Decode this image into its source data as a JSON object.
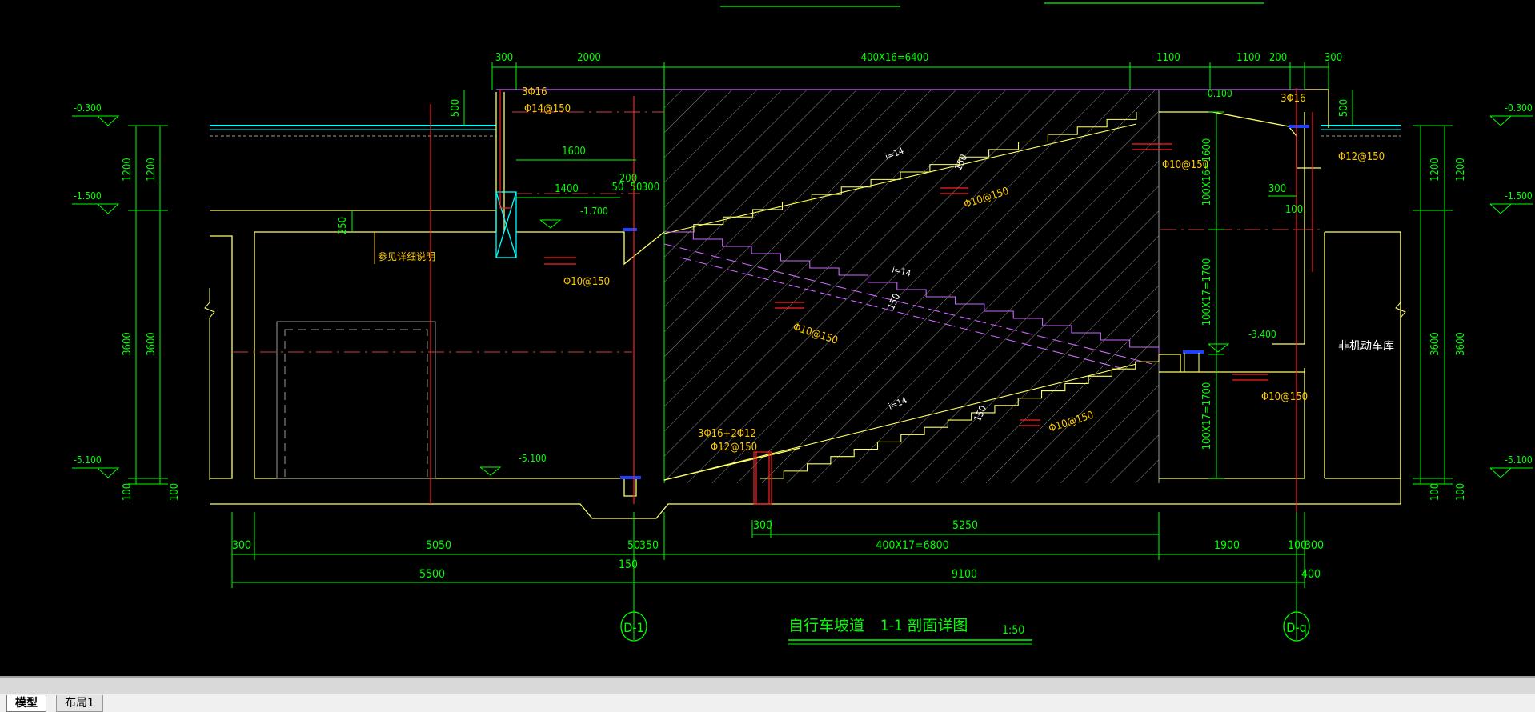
{
  "drawing": {
    "title": "自行车坡道",
    "section_label": "1-1  剖面详图",
    "scale": "1:50",
    "axis_left": "D-1",
    "axis_right": "D-q",
    "room_label": "非机动车库",
    "note_mid": "参见详细说明",
    "levels": {
      "top_left": "-0.300",
      "top_right": "-0.300",
      "mid_left": "-1.500",
      "mid_right": "-1.500",
      "bottom_left": "-5.100",
      "bottom_right": "-5.100",
      "landing_top": "-0.100",
      "landing_upper": "-1.700",
      "landing_mid": "-3.400",
      "floor": "-5.100"
    },
    "top_dims": [
      "300",
      "2000",
      "400X16=6400",
      "1100",
      "1100",
      "200",
      "300"
    ],
    "inner_dims": [
      "1600",
      "1400",
      "200",
      "50",
      "50",
      "300",
      "250",
      "500",
      "500",
      "300",
      "100"
    ],
    "bottom_dims_row1": [
      "300",
      "5050",
      "50",
      "350",
      "300",
      "5250",
      "400X17=6800",
      "1900",
      "100",
      "300"
    ],
    "bottom_dims_row2": [
      "5500",
      "150",
      "9100",
      "400"
    ],
    "left_vert_dims": [
      "1200",
      "1200",
      "3600",
      "3600",
      "100",
      "100"
    ],
    "right_vert_dims": [
      "1200",
      "1200",
      "3600",
      "3600",
      "100",
      "100"
    ],
    "stair_vert_dims": [
      "100X16=1600",
      "100X17=1700",
      "100X17=1700"
    ],
    "rebar_labels": [
      "3Φ16",
      "Φ14@150",
      "Φ10@150",
      "Φ10@150",
      "Φ10@150",
      "Φ10@150",
      "Φ10@150",
      "3Φ16",
      "Φ12@150",
      "3Φ16+2Φ12",
      "Φ12@150",
      "Φ10@150"
    ],
    "slope_labels": [
      "i=14",
      "i=14",
      "i=14"
    ],
    "slab_labels": [
      "150",
      "150",
      "150"
    ]
  },
  "tabs": {
    "model": "模型",
    "layout1": "布局1"
  },
  "colors": {
    "background": "#000000",
    "dim": "#00ff00",
    "wall": "#ffff66",
    "rebar": "#ff2020",
    "text": "#ffcc00",
    "ramp_mid": "#cc66ff",
    "hatch": "#9a9a9a",
    "cyan": "#00ffff"
  }
}
